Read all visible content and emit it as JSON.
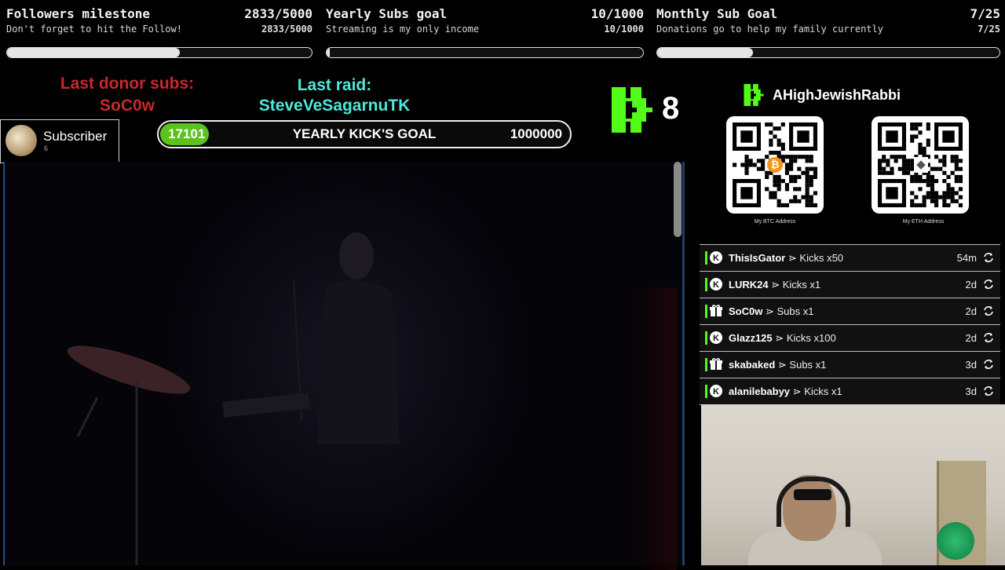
{
  "goals": [
    {
      "title": "Followers milestone",
      "count": "2833/5000",
      "subtitle": "Don't forget to hit the Follow!",
      "count_small": "2833/5000",
      "progress": 0.5666
    },
    {
      "title": "Yearly Subs goal",
      "count": "10/1000",
      "subtitle": "Streaming is my only income",
      "count_small": "10/1000",
      "progress": 0.01
    },
    {
      "title": "Monthly Sub Goal",
      "count": "7/25",
      "subtitle": "Donations go to help my family currently",
      "count_small": "7/25",
      "progress": 0.28
    }
  ],
  "last_donor": {
    "label": "Last donor subs:",
    "name": "SoC0w"
  },
  "last_raid": {
    "label": "Last raid:",
    "name": "SteveVeSagarnuTK"
  },
  "subscriber_card": {
    "label": "Subscriber",
    "count": "6"
  },
  "kick_goal": {
    "current": "17101",
    "label": "YEARLY KICK'S GOAL",
    "target": "1000000"
  },
  "kick_counter": {
    "value": "8"
  },
  "profile": {
    "name": "AHighJewishRabbi"
  },
  "qr_codes": [
    {
      "label": "My BTC Address",
      "coin": "bitcoin-icon"
    },
    {
      "label": "My ETH Address",
      "coin": "ethereum-icon"
    }
  ],
  "events": [
    {
      "icon": "kick-icon",
      "user": "ThisIsGator",
      "action": "Kicks x50",
      "time": "54m"
    },
    {
      "icon": "kick-icon",
      "user": "LURK24",
      "action": "Kicks x1",
      "time": "2d"
    },
    {
      "icon": "gift-icon",
      "user": "SoC0w",
      "action": "Subs x1",
      "time": "2d"
    },
    {
      "icon": "kick-icon",
      "user": "Glazz125",
      "action": "Kicks x100",
      "time": "2d"
    },
    {
      "icon": "gift-icon",
      "user": "skabaked",
      "action": "Subs x1",
      "time": "3d"
    },
    {
      "icon": "kick-icon",
      "user": "alanilebabyy",
      "action": "Kicks x1",
      "time": "3d"
    }
  ],
  "event_separator": "⋗",
  "colors": {
    "kick_green": "#53fc18",
    "donor_red": "#c8282d",
    "raid_cyan": "#4de8d8",
    "goal_pill": "#5bc21e"
  }
}
